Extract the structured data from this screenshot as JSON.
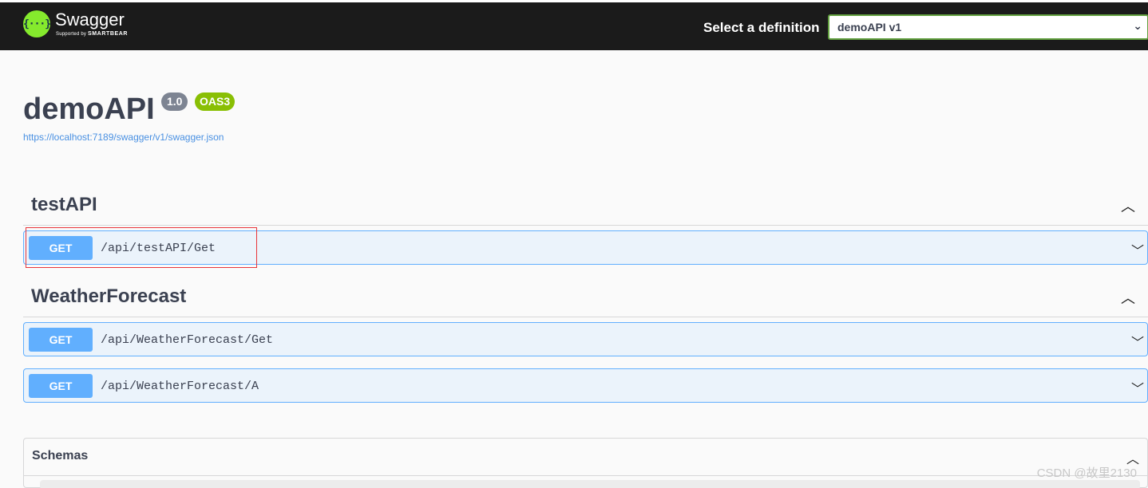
{
  "topbar": {
    "logo_icon": "{···}",
    "logo_name": "Swagger",
    "logo_sub_prefix": "Supported by",
    "logo_sub_brand": "SMARTBEAR",
    "definition_label": "Select a definition",
    "definition_value": "demoAPI v1"
  },
  "info": {
    "title": "demoAPI",
    "version": "1.0",
    "oas": "OAS3",
    "url": "https://localhost:7189/swagger/v1/swagger.json"
  },
  "tags": [
    {
      "name": "testAPI",
      "operations": [
        {
          "method": "GET",
          "path": "/api/testAPI/Get"
        }
      ]
    },
    {
      "name": "WeatherForecast",
      "operations": [
        {
          "method": "GET",
          "path": "/api/WeatherForecast/Get"
        },
        {
          "method": "GET",
          "path": "/api/WeatherForecast/A"
        }
      ]
    }
  ],
  "schemas": {
    "title": "Schemas"
  },
  "watermark": "CSDN @故里2130",
  "colors": {
    "topbar_bg": "#1b1b1b",
    "get_method": "#61affe",
    "get_bg": "#ebf3fb",
    "oas_badge": "#89bf04",
    "version_badge": "#7d8492",
    "select_border": "#62a03f",
    "highlight_box": "#e8353b"
  }
}
